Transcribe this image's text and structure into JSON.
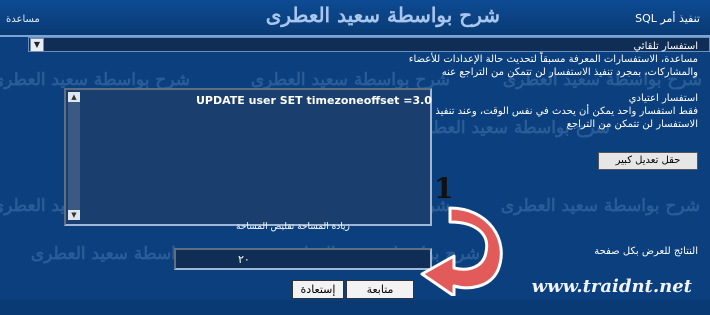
{
  "watermark": "شرح بواسطة سعيد العطرى",
  "brand": "شرح بواسطة سعيد العطرى",
  "header": {
    "title": "تنفيذ أمر SQL",
    "help": "مساعدة"
  },
  "query_modes": {
    "auto_title": "استفسار تلقائي",
    "auto_desc": "مساعدة، الاستفسارات المعرفة مسبقاً لتحديث حالة الإعدادات للأعضاء والمشاركات، بمجرد تنفيذ الاستفسار لن تتمكن من التراجع عنه",
    "manual_title": "استفسار اعتيادي",
    "manual_desc": "فقط استفسار واحد يمكن أن يحدث في نفس الوقت، وعند تنفيذ الاستفسار لن تتمكن من التراجع"
  },
  "query_text": "UPDATE user SET timezoneoffset =3.0",
  "resize_links": "زيادة المساحة  تقليص المساحة",
  "big_edit_button": "حقل تعديل كبير",
  "results_label": "النتائج للعرض بكل صفحة",
  "results_value": "٢٠",
  "buttons": {
    "submit": "متابعة",
    "reset": "إستعادة"
  },
  "site_url": "www.traidnt.net",
  "callout_number": "1",
  "colors": {
    "background": "#0b3f7e",
    "arrow": "#e35a5a"
  }
}
